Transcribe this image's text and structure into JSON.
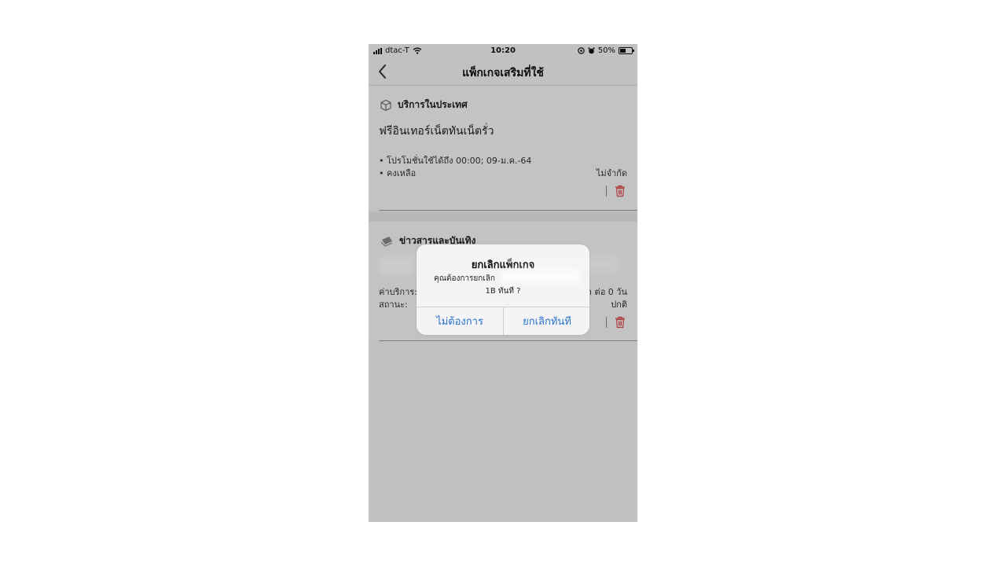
{
  "status_bar": {
    "carrier": "dtac-T",
    "time": "10:20",
    "battery": "50%"
  },
  "nav": {
    "title": "แพ็กเกจเสริมที่ใช้"
  },
  "card1": {
    "category": "บริการในประเทศ",
    "package_name": "ฟรีอินเทอร์เน็ตทันเน็ตรั่ว",
    "line1": "• โปรโมชั่นใช้ได้ถึง 00:00; 09-ม.ค.-64",
    "line2_label": "• คงเหลือ",
    "line2_value": "ไม่จำกัด"
  },
  "card2": {
    "category": "ข่าวสารและบันเทิง",
    "line1_label": "ค่าบริการ:",
    "line1_value": "า ต่อ 0 วัน",
    "line2_label": "สถานะ:",
    "line2_value": "ปกติ"
  },
  "dialog": {
    "title": "ยกเลิกแพ็กเกจ",
    "message_line1": "คุณต้องการยกเลิก",
    "message_line2": "1B ทันที ?",
    "cancel_label": "ไม่ต้องการ",
    "confirm_label": "ยกเลิกทันที"
  },
  "colors": {
    "link_blue": "#2a72c9",
    "trash_red": "#d94a4a",
    "screen_bg": "#f2f2f4"
  },
  "icons": {
    "category1": "box-icon",
    "category2": "newspaper-icon",
    "delete": "trash-icon"
  }
}
